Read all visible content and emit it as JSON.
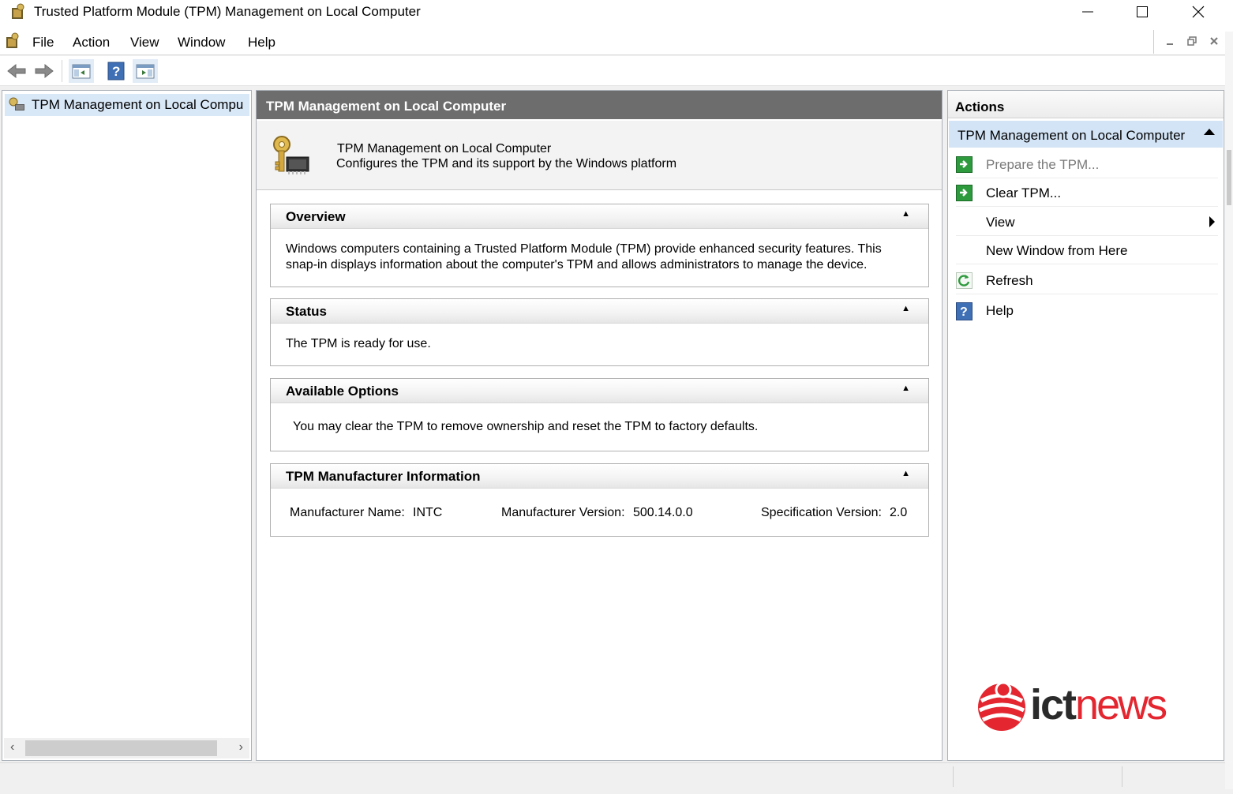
{
  "window": {
    "title": "Trusted Platform Module (TPM) Management on Local Computer",
    "app_icon": "tpm-key-icon"
  },
  "menu": {
    "items": [
      "File",
      "Action",
      "View",
      "Window",
      "Help"
    ]
  },
  "toolbar": {
    "buttons": [
      "back-arrow-icon",
      "forward-arrow-icon",
      "show-hide-console-tree-icon",
      "help-icon",
      "show-hide-action-pane-icon"
    ]
  },
  "tree": {
    "selected_item": "TPM Management on Local Compu"
  },
  "center": {
    "header": "TPM Management on Local Computer",
    "intro_title": "TPM Management on Local Computer",
    "intro_desc": "Configures the TPM and its support by the Windows platform",
    "sections": {
      "overview": {
        "title": "Overview",
        "line1": "Windows computers containing a Trusted Platform Module (TPM) provide enhanced security features. This",
        "line2": "snap-in displays information about the computer's TPM and allows administrators to manage the device."
      },
      "status": {
        "title": "Status",
        "text": "The TPM is ready for use."
      },
      "options": {
        "title": "Available Options",
        "text": "You may clear the TPM to remove ownership and reset the TPM to factory defaults."
      },
      "manufacturer": {
        "title": "TPM Manufacturer Information",
        "name_label": "Manufacturer Name:",
        "name_value": "INTC",
        "version_label": "Manufacturer Version:",
        "version_value": "500.14.0.0",
        "spec_label": "Specification Version:",
        "spec_value": "2.0"
      }
    }
  },
  "actions": {
    "header": "Actions",
    "group": "TPM Management on Local Computer",
    "items": {
      "prepare": "Prepare the TPM...",
      "clear": "Clear TPM...",
      "view": "View",
      "new_window": "New Window from Here",
      "refresh": "Refresh",
      "help": "Help"
    }
  },
  "watermark": {
    "brand_left": "ict",
    "brand_right": "news"
  },
  "colors": {
    "header_bg": "#6d6d6d",
    "selection_bg": "#d3e4f6",
    "action_green": "#1e8a2e",
    "brand_red": "#e3262f"
  }
}
